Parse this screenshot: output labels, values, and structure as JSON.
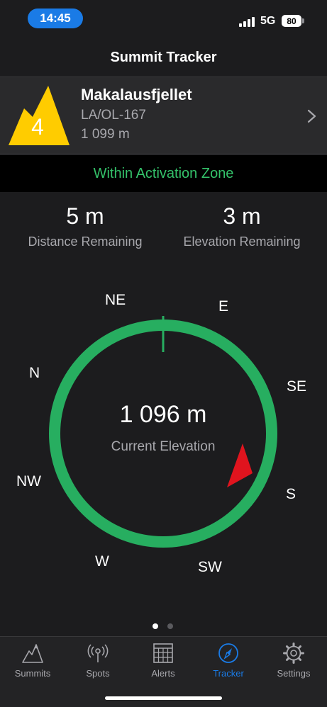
{
  "status": {
    "time": "14:45",
    "network": "5G",
    "battery": "80"
  },
  "nav": {
    "title": "Summit Tracker"
  },
  "summit": {
    "points": "4",
    "name": "Makalausfjellet",
    "reference": "LA/OL-167",
    "altitude": "1 099 m"
  },
  "zone": {
    "text": "Within Activation Zone"
  },
  "stats": {
    "distance_value": "5 m",
    "distance_label": "Distance Remaining",
    "elevation_value": "3 m",
    "elevation_label": "Elevation Remaining"
  },
  "compass": {
    "directions": {
      "ne": "NE",
      "e": "E",
      "se": "SE",
      "s": "S",
      "sw": "SW",
      "w": "W",
      "nw": "NW",
      "n": "N"
    },
    "current_elevation": "1 096 m",
    "current_elevation_label": "Current Elevation",
    "ring_color": "#27ae60",
    "needle_color": "#e0141e"
  },
  "pager": {
    "pages": 2,
    "current": 1
  },
  "tabs": [
    {
      "label": "Summits",
      "icon": "mountain-icon"
    },
    {
      "label": "Spots",
      "icon": "antenna-icon"
    },
    {
      "label": "Alerts",
      "icon": "calendar-grid-icon"
    },
    {
      "label": "Tracker",
      "icon": "compass-icon",
      "active": true
    },
    {
      "label": "Settings",
      "icon": "gear-icon"
    }
  ],
  "colors": {
    "accent": "#1a7be6",
    "zone_text": "#34c26a",
    "summit_badge": "#ffcc00"
  }
}
